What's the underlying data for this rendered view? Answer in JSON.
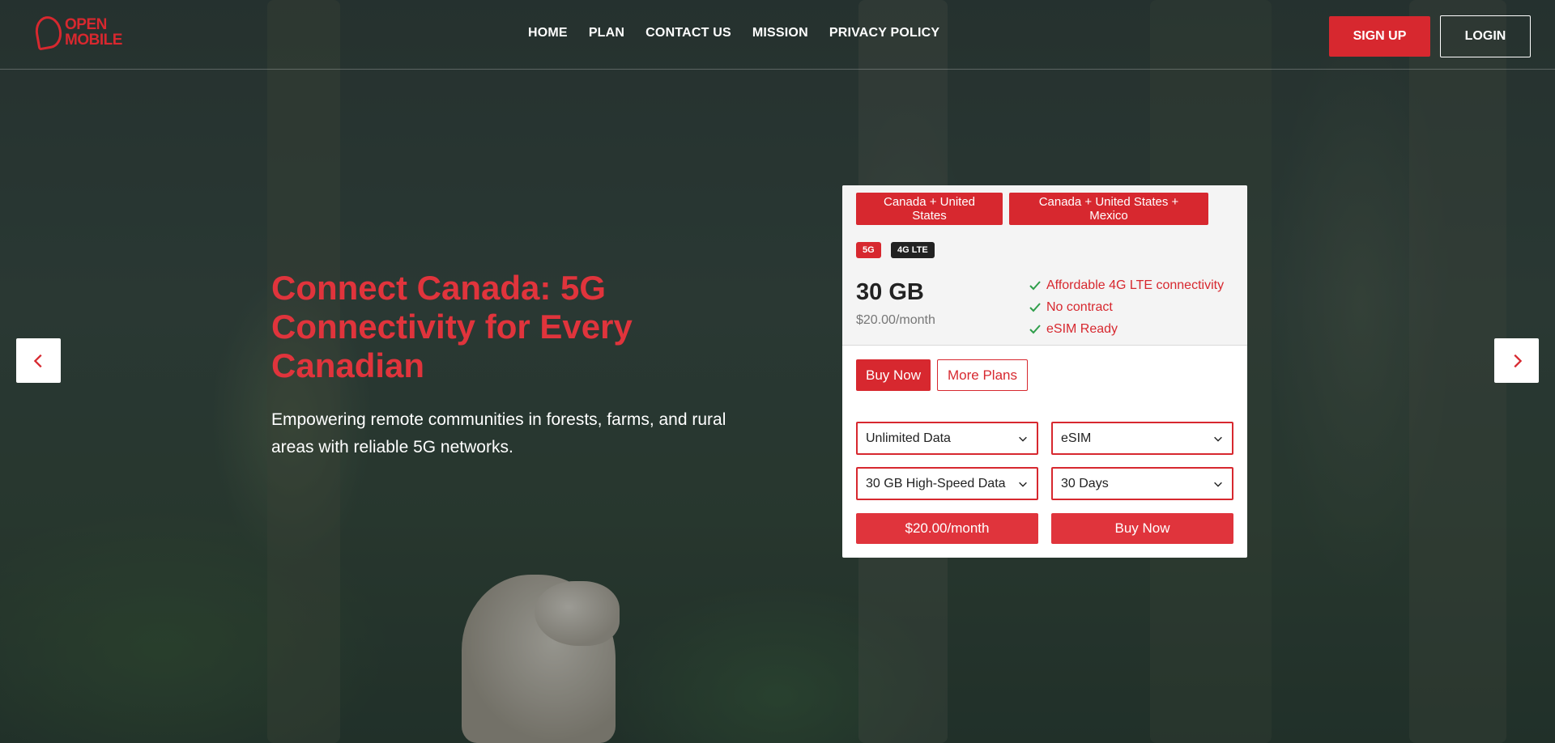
{
  "brand": {
    "logo_line1": "OPEN",
    "logo_line2": "MOBILE",
    "accent_color": "#d7282f"
  },
  "nav": {
    "items": [
      {
        "label": "HOME"
      },
      {
        "label": "PLAN"
      },
      {
        "label": "CONTACT US"
      },
      {
        "label": "MISSION"
      },
      {
        "label": "PRIVACY POLICY"
      }
    ],
    "signup_label": "SIGN UP",
    "login_label": "LOGIN"
  },
  "hero": {
    "title": "Connect Canada: 5G Connectivity for Every Canadian",
    "subtitle": "Empowering remote communities in forests, farms, and rural areas with reliable 5G networks.",
    "prev_icon": "chevron-left-icon",
    "next_icon": "chevron-right-icon"
  },
  "plan_card": {
    "regions": [
      {
        "label": "Canada + United States"
      },
      {
        "label": "Canada + United States + Mexico"
      }
    ],
    "badges": [
      "5G",
      "4G LTE"
    ],
    "data_amount": "30 GB",
    "price": "$20.00/month",
    "features": [
      "Affordable 4G LTE connectivity",
      "No contract",
      "eSIM Ready"
    ],
    "buy_now_label": "Buy Now",
    "more_plans_label": "More Plans",
    "selects": {
      "data_type": "Unlimited Data",
      "sim_type": "eSIM",
      "data_amount": "30 GB High-Speed Data",
      "duration": "30 Days"
    },
    "price_button_label": "$20.00/month",
    "buy_now_big_label": "Buy Now"
  }
}
